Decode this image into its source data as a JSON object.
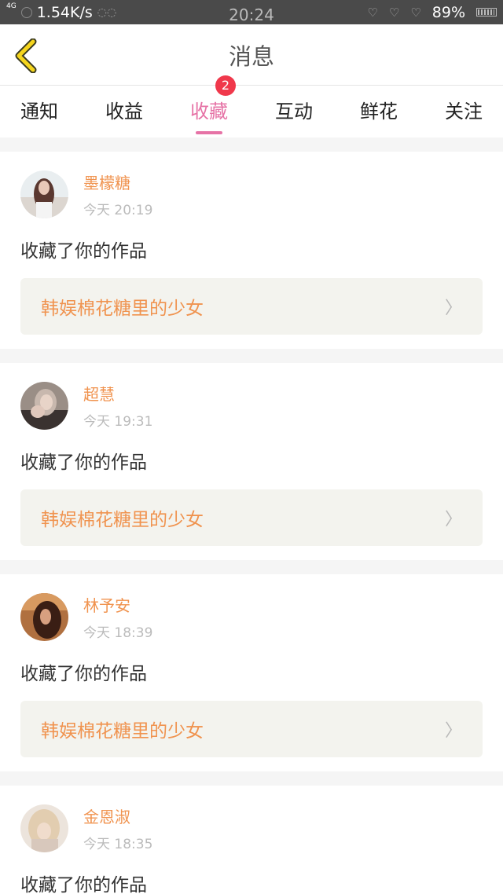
{
  "statusbar": {
    "network": "4G",
    "speed": "1.54K/s",
    "time": "20:24",
    "battery": "89%"
  },
  "navbar": {
    "title": "消息"
  },
  "tabs": [
    {
      "label": "通知"
    },
    {
      "label": "收益"
    },
    {
      "label": "收藏",
      "badge": "2",
      "active": true
    },
    {
      "label": "互动"
    },
    {
      "label": "鲜花"
    },
    {
      "label": "关注"
    }
  ],
  "items": [
    {
      "user": "墨檬糖",
      "time": "今天 20:19",
      "action": "收藏了你的作品",
      "work": "韩娱棉花糖里的少女"
    },
    {
      "user": "超慧",
      "time": "今天 19:31",
      "action": "收藏了你的作品",
      "work": "韩娱棉花糖里的少女"
    },
    {
      "user": "林予安",
      "time": "今天 18:39",
      "action": "收藏了你的作品",
      "work": "韩娱棉花糖里的少女"
    },
    {
      "user": "金恩淑",
      "time": "今天 18:35",
      "action": "收藏了你的作品"
    }
  ],
  "colors": {
    "accent": "#e673a6",
    "orange": "#f0934f",
    "badge": "#f0384b"
  }
}
